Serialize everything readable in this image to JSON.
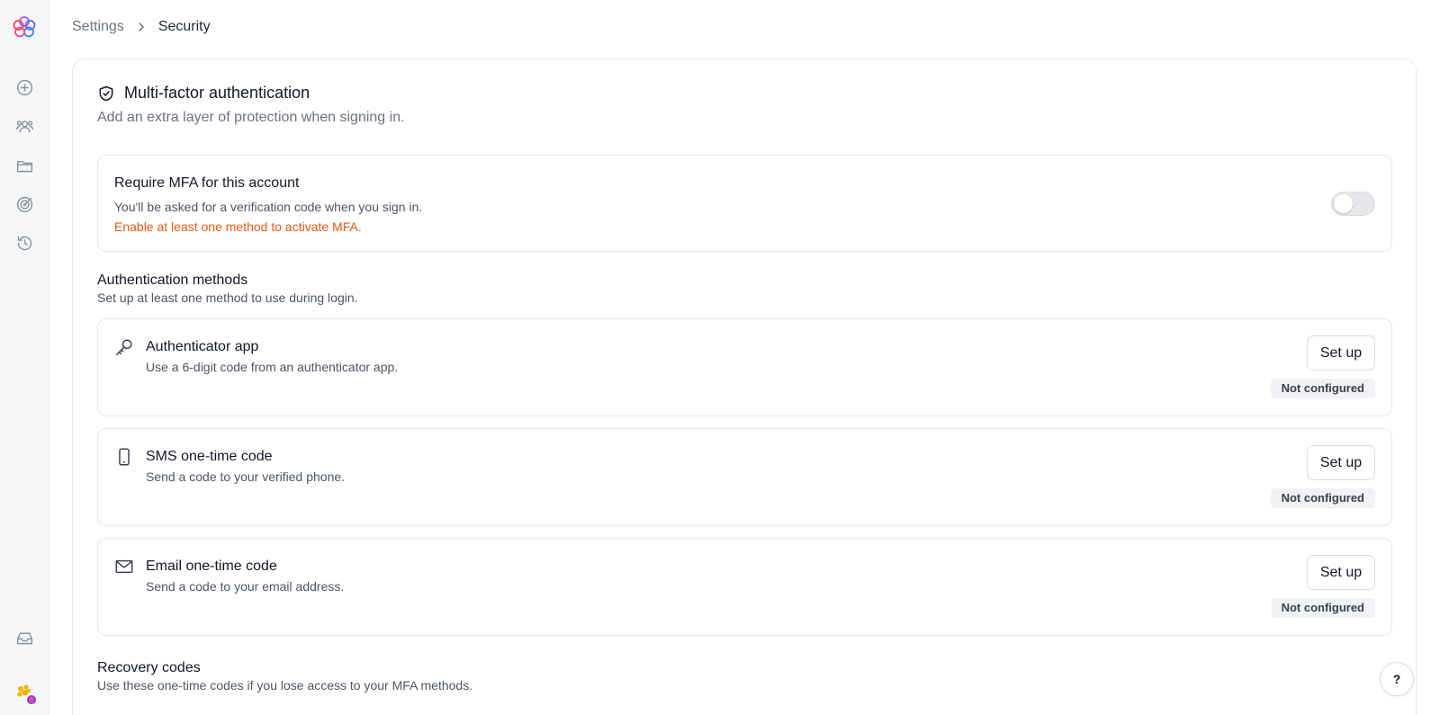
{
  "breadcrumb": {
    "root": "Settings",
    "current": "Security"
  },
  "rail": {
    "items": [
      "plus-circle-icon",
      "users-icon",
      "folder-icon",
      "target-icon",
      "history-icon",
      "inbox-icon"
    ]
  },
  "mfa": {
    "title": "Multi-factor authentication",
    "subtitle": "Add an extra layer of protection when signing in.",
    "require": {
      "title": "Require MFA for this account",
      "description": "You'll be asked for a verification code when you sign in.",
      "warning": "Enable at least one method to activate MFA.",
      "enabled": false
    }
  },
  "methods_section": {
    "title": "Authentication methods",
    "subtitle": "Set up at least one method to use during login."
  },
  "methods": [
    {
      "icon": "key-icon",
      "title": "Authenticator app",
      "description": "Use a 6-digit code from an authenticator app.",
      "button": "Set up",
      "status": "Not configured"
    },
    {
      "icon": "phone-icon",
      "title": "SMS one-time code",
      "description": "Send a code to your verified phone.",
      "button": "Set up",
      "status": "Not configured"
    },
    {
      "icon": "mail-icon",
      "title": "Email one-time code",
      "description": "Send a code to your email address.",
      "button": "Set up",
      "status": "Not configured"
    }
  ],
  "recovery": {
    "title": "Recovery codes",
    "subtitle": "Use these one-time codes if you lose access to your MFA methods."
  },
  "help": {
    "label": "?"
  },
  "colors": {
    "warning": "#ea580c",
    "rail_bg": "#f5f6f8",
    "border": "#e6e8ec",
    "badge_bg": "#f1f2f5"
  }
}
